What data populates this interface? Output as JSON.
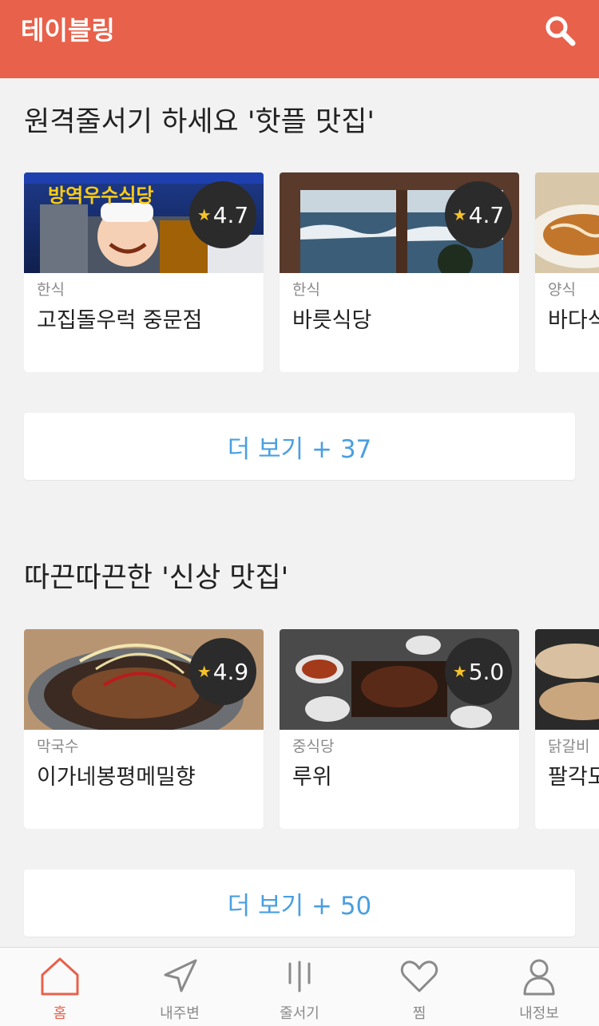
{
  "header": {
    "title": "테이블링",
    "search_icon": "search-icon"
  },
  "sections": [
    {
      "title": "원격줄서기 하세요 '핫플 맛집'",
      "cards": [
        {
          "rating": "4.7",
          "category": "한식",
          "name": "고집돌우럭 중문점",
          "image_text": "방역우수식당"
        },
        {
          "rating": "4.7",
          "category": "한식",
          "name": "바릇식당"
        },
        {
          "category": "양식",
          "name": "바다식"
        }
      ],
      "more": "더 보기 + 37"
    },
    {
      "title": "따끈따끈한 '신상 맛집'",
      "cards": [
        {
          "rating": "4.9",
          "category": "막국수",
          "name": "이가네봉평메밀향"
        },
        {
          "rating": "5.0",
          "category": "중식당",
          "name": "루위"
        },
        {
          "category": "닭갈비",
          "name": "팔각도"
        }
      ],
      "more": "더 보기 + 50"
    }
  ],
  "tabs": [
    {
      "label": "홈",
      "icon": "home-icon",
      "active": true
    },
    {
      "label": "내주변",
      "icon": "location-arrow-icon",
      "active": false
    },
    {
      "label": "줄서기",
      "icon": "queue-lines-icon",
      "active": false
    },
    {
      "label": "찜",
      "icon": "heart-icon",
      "active": false
    },
    {
      "label": "내정보",
      "icon": "user-icon",
      "active": false
    }
  ],
  "colors": {
    "accent": "#e8614b",
    "link": "#4a9fe0",
    "rating_bg": "#2b2b2b",
    "star": "#f4c22a"
  }
}
